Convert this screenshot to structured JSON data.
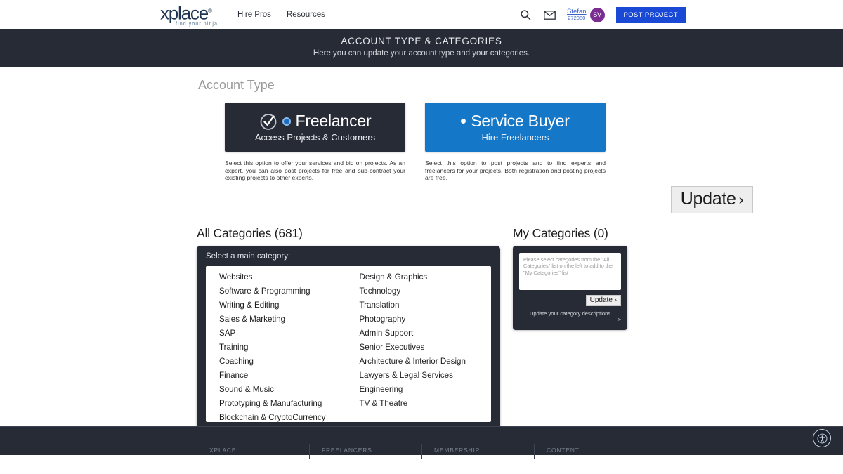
{
  "header": {
    "logo": {
      "text": "xplace",
      "registered": "®",
      "tagline": "find your ninja"
    },
    "nav": [
      {
        "label": "Hire Pros",
        "name": "nav-hire-pros"
      },
      {
        "label": "Resources",
        "name": "nav-resources"
      }
    ],
    "icons": {
      "search": "search-icon",
      "mail": "mail-icon"
    },
    "user": {
      "name": "Stefan",
      "id": "272080",
      "initials": "SV",
      "avatar_color": "#7b2d91"
    },
    "post_project_label": "POST PROJECT",
    "post_project_color": "#1a49d6"
  },
  "banner": {
    "title": "ACCOUNT TYPE & CATEGORIES",
    "subtitle": "Here you can update your account type and your categories.",
    "bg": "#262b36"
  },
  "account_type": {
    "section_title": "Account Type",
    "cards": [
      {
        "title": "Freelancer",
        "subtitle": "Access Projects & Customers",
        "description": "Select this option to offer your services and bid on projects. As an expert, you can also post projects for free and sub-contract your existing projects to other experts.",
        "selected": true,
        "bg": "#262b36"
      },
      {
        "title": "Service Buyer",
        "subtitle": "Hire Freelancers",
        "description": "Select this option to post projects and to find experts and freelancers for your projects. Both registration and posting projects are free.",
        "selected": false,
        "bg": "#1477c8"
      }
    ],
    "update_label": "Update",
    "update_chevron": "›"
  },
  "all_categories": {
    "heading": "All Categories (681)",
    "count": 681,
    "panel_label": "Select a main category:",
    "left_column": [
      "Websites",
      "Software & Programming",
      "Writing & Editing",
      "Sales & Marketing",
      "SAP",
      "Training",
      "Coaching",
      "Finance",
      "Sound & Music",
      "Prototyping & Manufacturing",
      "Blockchain & CryptoCurrency"
    ],
    "right_column": [
      "Design & Graphics",
      "Technology",
      "Translation",
      "Photography",
      "Admin Support",
      "Senior Executives",
      "Architecture & Interior Design",
      "Lawyers & Legal Services",
      "Engineering",
      "TV & Theatre"
    ]
  },
  "my_categories": {
    "heading": "My Categories (0)",
    "count": 0,
    "empty_message": "Please select categories from the \"All Categories\" list on the left to add to the \"My Categories\" list",
    "update_label": "Update ›",
    "footer_link": "Update your category descriptions",
    "footer_chevron": "»"
  },
  "footer": {
    "columns": [
      "XPLACE",
      "FREELANCERS",
      "MEMBERSHIP",
      "CONTENT"
    ],
    "accessibility_icon": "accessibility-icon"
  }
}
